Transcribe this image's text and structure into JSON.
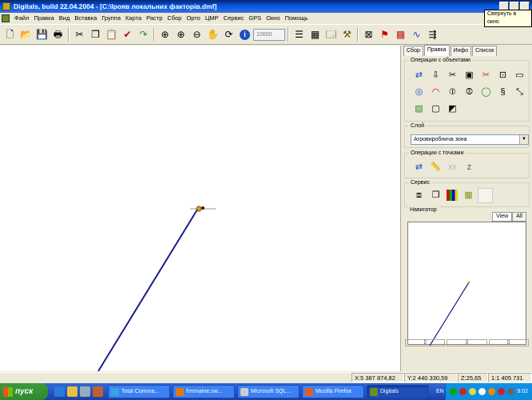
{
  "window": {
    "title": "Digitals, build 22.04.2004 - [C:\\Iрояв локальних факторів.dmf]",
    "tooltip": "Свернуть в окно"
  },
  "menu": [
    "Файл",
    "Правка",
    "Вид",
    "Вставка",
    "Группа",
    "Карта",
    "Растр",
    "Сбор",
    "Орто",
    "ЦМР",
    "Сервис",
    "GPS",
    "Окно",
    "Помощь"
  ],
  "toolbar": {
    "scale_placeholder": "10000"
  },
  "tabs": [
    "Сбор",
    "Правка",
    "Инфо",
    "Список"
  ],
  "active_tab": "Правка",
  "groups": {
    "objects": "Операции с объектами",
    "layer": "Слой",
    "points": "Операции с точками",
    "service": "Сервис",
    "navigator": "Навигатор"
  },
  "layer_value": "Агровиробнича зона",
  "points_labels": {
    "xy": "XY",
    "z": "Z"
  },
  "nav_tabs": [
    "View",
    "All"
  ],
  "status": {
    "x": "X:5 387 874,82",
    "y": "Y:2 440 330,59",
    "z": "Z:25,65",
    "scale": "1:1 405 731"
  },
  "taskbar": {
    "start": "пуск",
    "tasks": [
      "Total Comma...",
      "frmmaine.sw...",
      "Microsoft SQL...",
      "Mozilla Firefox",
      "Digitals"
    ],
    "lang": "EN",
    "clock": "9:02"
  }
}
